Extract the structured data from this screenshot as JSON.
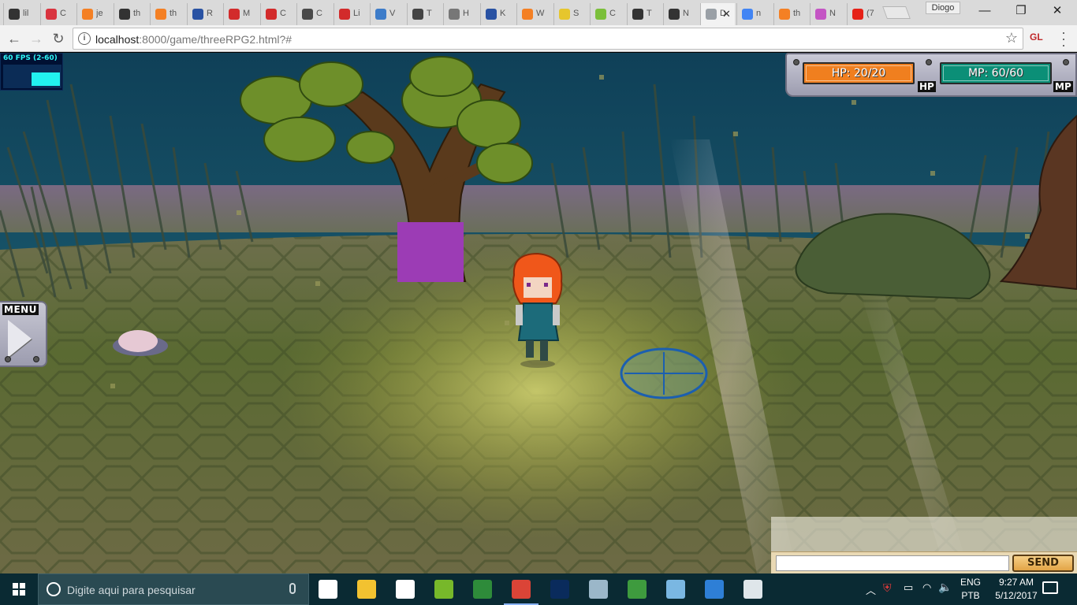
{
  "browser": {
    "tabs": [
      {
        "title": "lil",
        "icon": "github-icon",
        "color": "#333333"
      },
      {
        "title": "C",
        "icon": "oval-icon",
        "color": "#d9343f"
      },
      {
        "title": "je",
        "icon": "stack-icon",
        "color": "#f48024"
      },
      {
        "title": "th",
        "icon": "github-icon",
        "color": "#333333"
      },
      {
        "title": "th",
        "icon": "stack-icon",
        "color": "#f48024"
      },
      {
        "title": "R",
        "icon": "m-icon",
        "color": "#2952a3"
      },
      {
        "title": "M",
        "icon": "three-icon",
        "color": "#d22b2b"
      },
      {
        "title": "C",
        "icon": "three-icon",
        "color": "#d22b2b"
      },
      {
        "title": "C",
        "icon": "bolt-icon",
        "color": "#4a4a4a"
      },
      {
        "title": "Li",
        "icon": "three-icon",
        "color": "#d22b2b"
      },
      {
        "title": "V",
        "icon": "eye-icon",
        "color": "#3d7cc9"
      },
      {
        "title": "T",
        "icon": "wiki-icon",
        "color": "#444444"
      },
      {
        "title": "H",
        "icon": "diamond-icon",
        "color": "#777777"
      },
      {
        "title": "K",
        "icon": "m-icon",
        "color": "#2952a3"
      },
      {
        "title": "W",
        "icon": "stack-icon",
        "color": "#f48024"
      },
      {
        "title": "S",
        "icon": "smile-icon",
        "color": "#e6c62d"
      },
      {
        "title": "C",
        "icon": "leaf-icon",
        "color": "#7bbf3a"
      },
      {
        "title": "T",
        "icon": "github-icon",
        "color": "#333333"
      },
      {
        "title": "N",
        "icon": "github-icon",
        "color": "#333333"
      },
      {
        "title": "D",
        "icon": "page-icon",
        "color": "#9aa0a6",
        "active": true
      },
      {
        "title": "n",
        "icon": "google-icon",
        "color": "#4285f4"
      },
      {
        "title": "th",
        "icon": "stack-icon",
        "color": "#f48024"
      },
      {
        "title": "N",
        "icon": "triangle-icon",
        "color": "#c455c4"
      },
      {
        "title": "(7",
        "icon": "youtube-icon",
        "color": "#e62117"
      }
    ],
    "profile_name": "Diogo",
    "url_host": "localhost",
    "url_rest": ":8000/game/threeRPG2.html?#",
    "extension_label": "GL",
    "window_controls": {
      "minimize": "—",
      "maximize": "❐",
      "close": "✕"
    }
  },
  "game": {
    "fps_label": "60 FPS (2-60)",
    "fps_fraction": 0.5,
    "hp": {
      "label": "HP: 20/20",
      "tag": "HP",
      "current": 20,
      "max": 20,
      "color": "#f07f1f"
    },
    "mp": {
      "label": "MP: 60/60",
      "tag": "MP",
      "current": 60,
      "max": 60,
      "color": "#0b8f77"
    },
    "menu_label": "MENU",
    "chat": {
      "input_value": "",
      "send_label": "SEND"
    }
  },
  "taskbar": {
    "search_placeholder": "Digite aqui para pesquisar",
    "apps": [
      {
        "name": "task-view-icon",
        "color": "#ffffff"
      },
      {
        "name": "file-explorer-icon",
        "color": "#f2c230"
      },
      {
        "name": "store-icon",
        "color": "#ffffff"
      },
      {
        "name": "game-app-icon",
        "color": "#77b82a"
      },
      {
        "name": "notes-app-icon",
        "color": "#2e8b3a"
      },
      {
        "name": "chrome-icon",
        "color": "#db4437",
        "active": true
      },
      {
        "name": "photoshop-icon",
        "color": "#0a2b5c"
      },
      {
        "name": "image-viewer-icon",
        "color": "#9bb7c9"
      },
      {
        "name": "chart-editor-icon",
        "color": "#3e9b3e"
      },
      {
        "name": "paint-app-icon",
        "color": "#7ab7e2"
      },
      {
        "name": "tetris-app-icon",
        "color": "#2e7fd6"
      },
      {
        "name": "window-app-icon",
        "color": "#dfe6ea"
      }
    ],
    "lang_top": "ENG",
    "lang_bottom": "PTB",
    "time": "9:27 AM",
    "date": "5/12/2017"
  }
}
